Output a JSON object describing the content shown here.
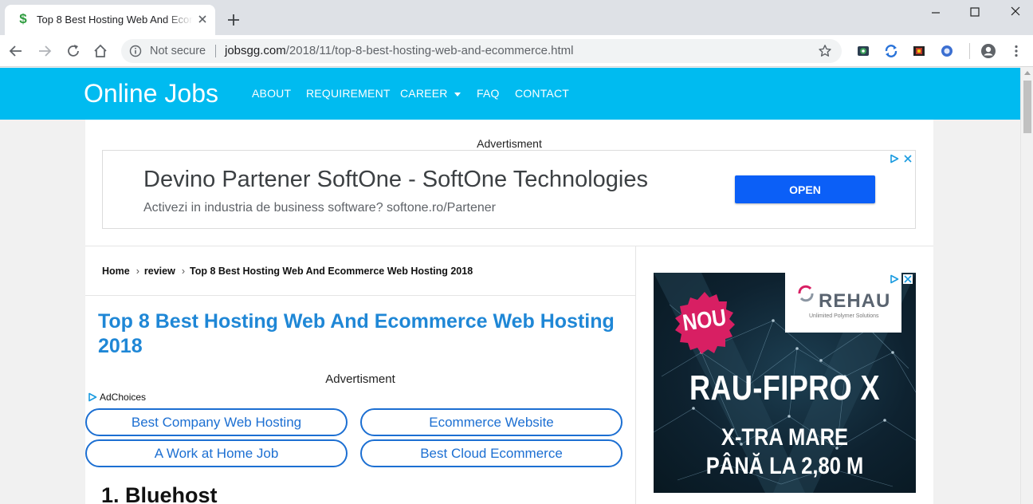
{
  "browser": {
    "tab_title": "Top 8 Best Hosting Web And Ecommerce Web Hosting 2018",
    "security_label": "Not secure",
    "url_domain": "jobsgg.com",
    "url_path": "/2018/11/top-8-best-hosting-web-and-ecommerce.html"
  },
  "site": {
    "brand": "Online Jobs",
    "nav": [
      "ABOUT",
      "REQUIREMENT",
      "CAREER",
      "FAQ",
      "CONTACT"
    ]
  },
  "top_ad": {
    "caption": "Advertisment",
    "headline": "Devino Partener SoftOne - SoftOne Technologies",
    "subline": "Activezi in industria de business software? softone.ro/Partener",
    "button": "OPEN"
  },
  "breadcrumb": [
    "Home",
    "review",
    "Top 8 Best Hosting Web And Ecommerce Web Hosting 2018"
  ],
  "post": {
    "title": "Top 8 Best Hosting Web And Ecommerce Web Hosting 2018",
    "ad_caption": "Advertisment",
    "adchoices": "AdChoices",
    "links": [
      "Best Company Web Hosting",
      "Ecommerce Website",
      "A Work at Home Job",
      "Best Cloud Ecommerce"
    ],
    "section_heading": "1. Bluehost"
  },
  "side_ad": {
    "badge": "NOU",
    "brand": "REHAU",
    "tagline": "Unlimited Polymer Solutions",
    "product": "RAU-FIPRO X",
    "line1": "X-TRA MARE",
    "line2": "PÂNĂ LA 2,80 M"
  },
  "colors": {
    "header_bg": "#00bbf0",
    "title_blue": "#1f87d6",
    "open_button": "#0b5ff7",
    "pill_border": "#1c6fd2",
    "nou_badge": "#d81f63"
  }
}
